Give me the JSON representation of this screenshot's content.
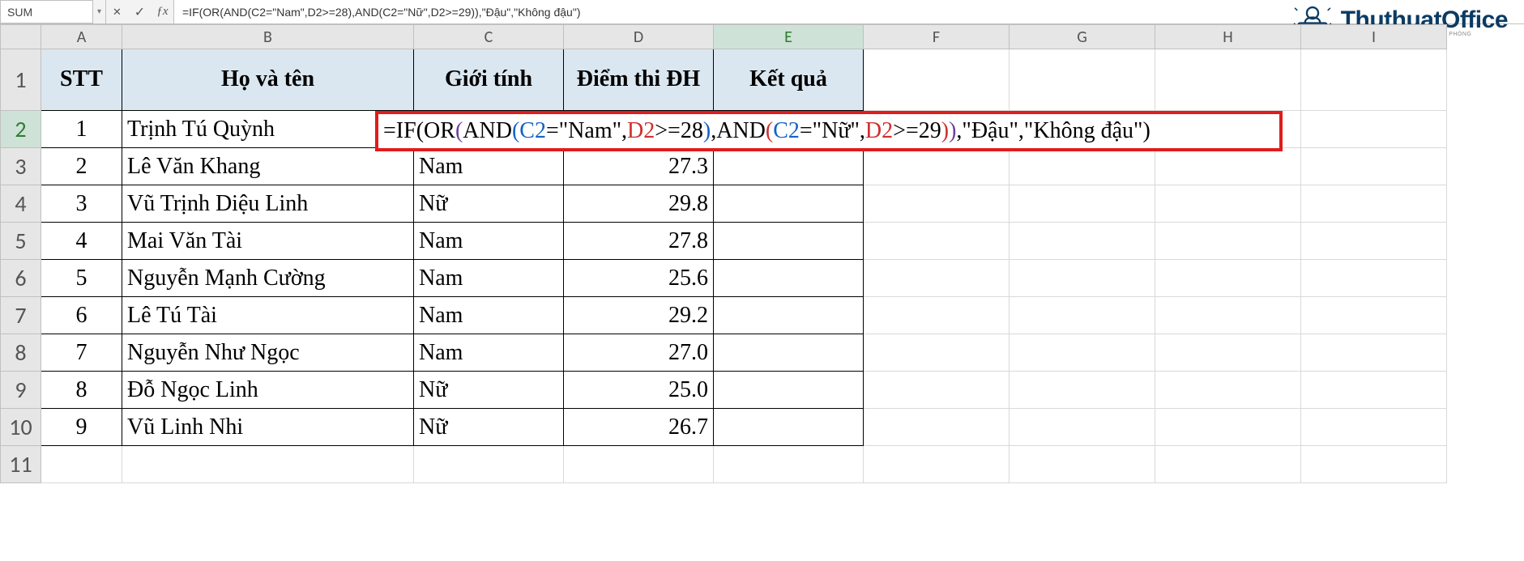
{
  "formula_bar": {
    "name_box": "SUM",
    "cancel_glyph": "✕",
    "enter_glyph": "✓",
    "fx_glyph": "ƒx",
    "formula_text": "=IF(OR(AND(C2=\"Nam\",D2>=28),AND(C2=\"Nữ\",D2>=29)),\"Đậu\",\"Không đậu\")"
  },
  "logo": {
    "brand": "ThuthuatOffice",
    "tagline": "TẤT TẦN TẬT MỌI THỦ THUẬT VĂN PHÒNG"
  },
  "columns": [
    "A",
    "B",
    "C",
    "D",
    "E",
    "F",
    "G",
    "H",
    "I"
  ],
  "row_numbers": [
    "1",
    "2",
    "3",
    "4",
    "5",
    "6",
    "7",
    "8",
    "9",
    "10",
    "11"
  ],
  "header_row": {
    "A": "STT",
    "B": "Họ và tên",
    "C": "Giới tính",
    "D": "Điểm thi ĐH",
    "E": "Kết quả"
  },
  "data_rows": [
    {
      "stt": "1",
      "name": "Trịnh Tú Quỳnh",
      "gender": "",
      "score": "",
      "result_formula": true
    },
    {
      "stt": "2",
      "name": "Lê Văn Khang",
      "gender": "Nam",
      "score": "27.3",
      "result_formula": false
    },
    {
      "stt": "3",
      "name": "Vũ Trịnh Diệu Linh",
      "gender": "Nữ",
      "score": "29.8",
      "result_formula": false
    },
    {
      "stt": "4",
      "name": "Mai Văn Tài",
      "gender": "Nam",
      "score": "27.8",
      "result_formula": false
    },
    {
      "stt": "5",
      "name": "Nguyễn Mạnh Cường",
      "gender": "Nam",
      "score": "25.6",
      "result_formula": false
    },
    {
      "stt": "6",
      "name": "Lê Tú Tài",
      "gender": "Nam",
      "score": "29.2",
      "result_formula": false
    },
    {
      "stt": "7",
      "name": "Nguyễn Như Ngọc",
      "gender": "Nam",
      "score": "27.0",
      "result_formula": false
    },
    {
      "stt": "8",
      "name": "Đỗ Ngọc Linh",
      "gender": "Nữ",
      "score": "25.0",
      "result_formula": false
    },
    {
      "stt": "9",
      "name": "Vũ Linh Nhi",
      "gender": "Nữ",
      "score": "26.7",
      "result_formula": false
    }
  ],
  "overlay_formula": {
    "pre": "=",
    "IF": "IF",
    "OR": "OR",
    "AND": "AND",
    "C2": "C2",
    "D2": "D2",
    "eqNam": "=\"Nam\",",
    "ge28": ">=28",
    "eqNu": "=\"Nữ\",",
    "ge29": ">=29",
    "comma": ",",
    "dau": "\"Đậu\"",
    "kd": "\"Không đậu\"",
    "lp": "(",
    "rp": ")"
  }
}
